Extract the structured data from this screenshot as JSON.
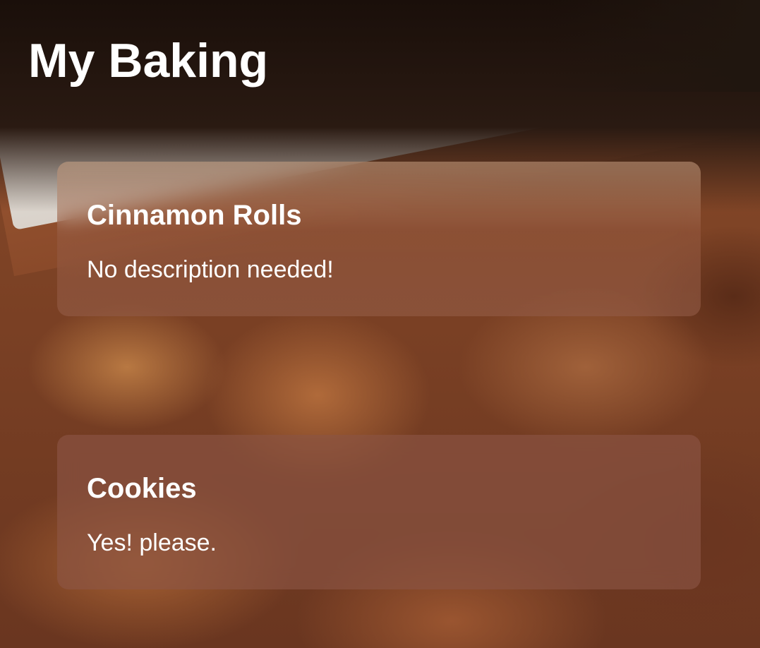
{
  "page": {
    "title": "My Baking"
  },
  "recipes": [
    {
      "name": "Cinnamon Rolls",
      "description": "No description needed!"
    },
    {
      "name": "Cookies",
      "description": "Yes! please."
    }
  ],
  "colors": {
    "text": "#ffffff",
    "card_tint": "#965f4b"
  }
}
